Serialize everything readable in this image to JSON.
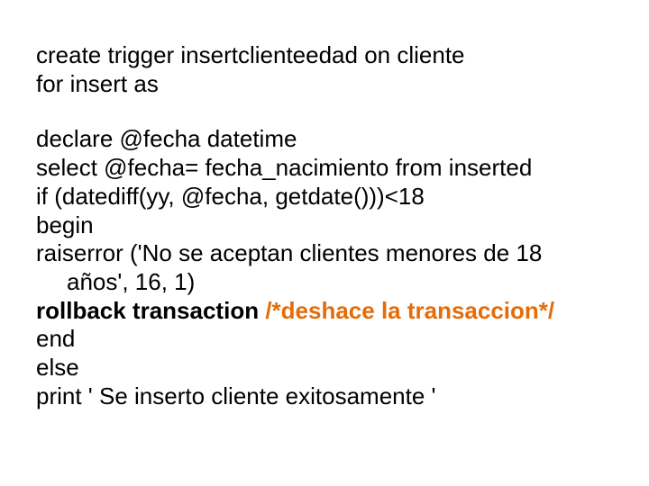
{
  "block1_line1": "create trigger insertclienteedad on cliente",
  "block1_line2": "for insert as",
  "block2_line1": "declare @fecha datetime",
  "block2_line2": "select @fecha= fecha_nacimiento from inserted",
  "block2_line3": "if (datediff(yy, @fecha, getdate()))<18",
  "block2_line4": "begin",
  "block2_line5a": "raiserror ('No se aceptan clientes menores de 18 ",
  "block2_line5b": "años', 16, 1)",
  "block2_line6a": "rollback transaction ",
  "block2_line6b": "/*deshace la transaccion*/",
  "block2_line7": "end",
  "block2_line8": "else",
  "block2_line9": "print ' Se inserto cliente exitosamente '"
}
